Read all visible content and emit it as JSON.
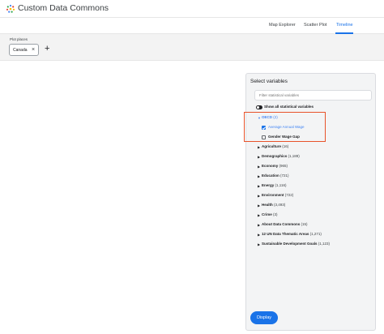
{
  "app": {
    "title": "Custom Data Commons",
    "logo_icon": "data-commons-logo-icon"
  },
  "nav": {
    "items": [
      {
        "label": "Map Explorer",
        "active": false
      },
      {
        "label": "Scatter Plot",
        "active": false
      },
      {
        "label": "Timeline",
        "active": true
      }
    ],
    "accent_color": "#1a73e8"
  },
  "places": {
    "label": "Plot places",
    "chips": [
      {
        "label": "Canada",
        "close_icon": "close-icon"
      }
    ],
    "add_icon": "plus-icon"
  },
  "panel": {
    "title": "Select variables",
    "filter_placeholder": "Filter statistical variables",
    "toggle_label": "Show all statistical variables",
    "toggle_on": true,
    "oecd": {
      "label": "OECD",
      "count": "(2)",
      "expanded": true,
      "variables": [
        {
          "label": "Average Annual Wage",
          "checked": true
        },
        {
          "label": "Gender Wage Gap",
          "checked": false
        }
      ]
    },
    "categories": [
      {
        "label": "Agriculture",
        "count": "(16)"
      },
      {
        "label": "Demographics",
        "count": "(1,189)"
      },
      {
        "label": "Economy",
        "count": "(965)"
      },
      {
        "label": "Education",
        "count": "(721)"
      },
      {
        "label": "Energy",
        "count": "(1,116)"
      },
      {
        "label": "Environment",
        "count": "(722)"
      },
      {
        "label": "Health",
        "count": "(3,493)"
      },
      {
        "label": "Crime",
        "count": "(3)"
      },
      {
        "label": "About Data Commons",
        "count": "(15)"
      },
      {
        "label": "12 UN Data Thematic Areas",
        "count": "(1,271)"
      },
      {
        "label": "Sustainable Development Goals",
        "count": "(1,123)"
      }
    ],
    "display_label": "Display",
    "highlight_color": "#e8532a"
  }
}
